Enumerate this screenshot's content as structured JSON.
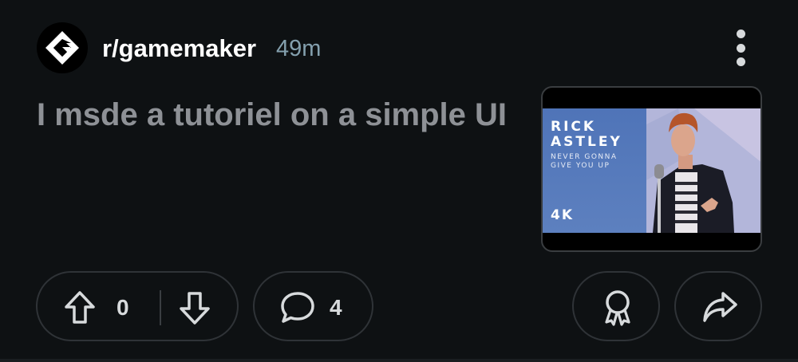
{
  "post": {
    "subreddit": "r/gamemaker",
    "time_ago": "49m",
    "title": "I msde a tutoriel on a simple UI"
  },
  "thumbnail": {
    "artist": "RICK ASTLEY",
    "song": "NEVER GONNA GIVE YOU UP",
    "quality": "4K"
  },
  "actions": {
    "upvote_count": "0",
    "comment_count": "4"
  },
  "icons": {
    "avatar": "gamemaker-logo-icon",
    "menu": "kebab-menu-icon",
    "upvote": "arrow-up-icon",
    "downvote": "arrow-down-icon",
    "comments": "speech-bubble-icon",
    "award": "award-ribbon-icon",
    "share": "share-arrow-icon"
  },
  "colors": {
    "background": "#0e1113",
    "text_primary": "#ffffff",
    "text_muted_title": "#8e9196",
    "timestamp": "#84a0ae",
    "pill_border": "#2f3337"
  }
}
